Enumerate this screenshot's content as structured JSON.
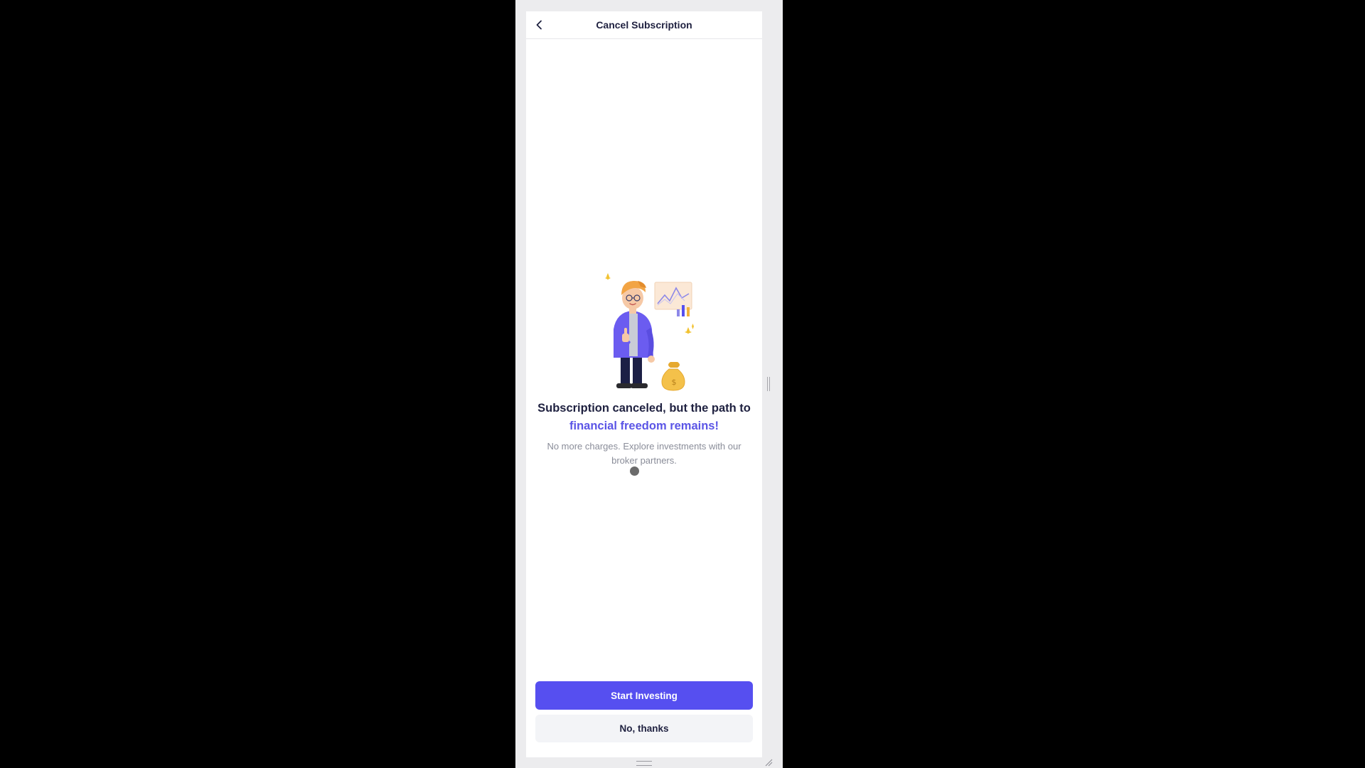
{
  "header": {
    "title": "Cancel Subscription",
    "back_icon": "chevron-left-icon"
  },
  "illustration": {
    "description_icon": "person-thumbs-up-investing-icon"
  },
  "message": {
    "headline_part1": "Subscription canceled, but the path to ",
    "headline_accent": "financial freedom remains!",
    "subtext": "No more charges. Explore investments with our broker partners."
  },
  "actions": {
    "primary_label": "Start Investing",
    "secondary_label": "No, thanks"
  },
  "colors": {
    "accent": "#564ff0",
    "accent_text": "#5b55e6",
    "heading": "#1f2140",
    "muted_text": "#8a8d99",
    "secondary_button_bg": "#f3f4f7"
  }
}
